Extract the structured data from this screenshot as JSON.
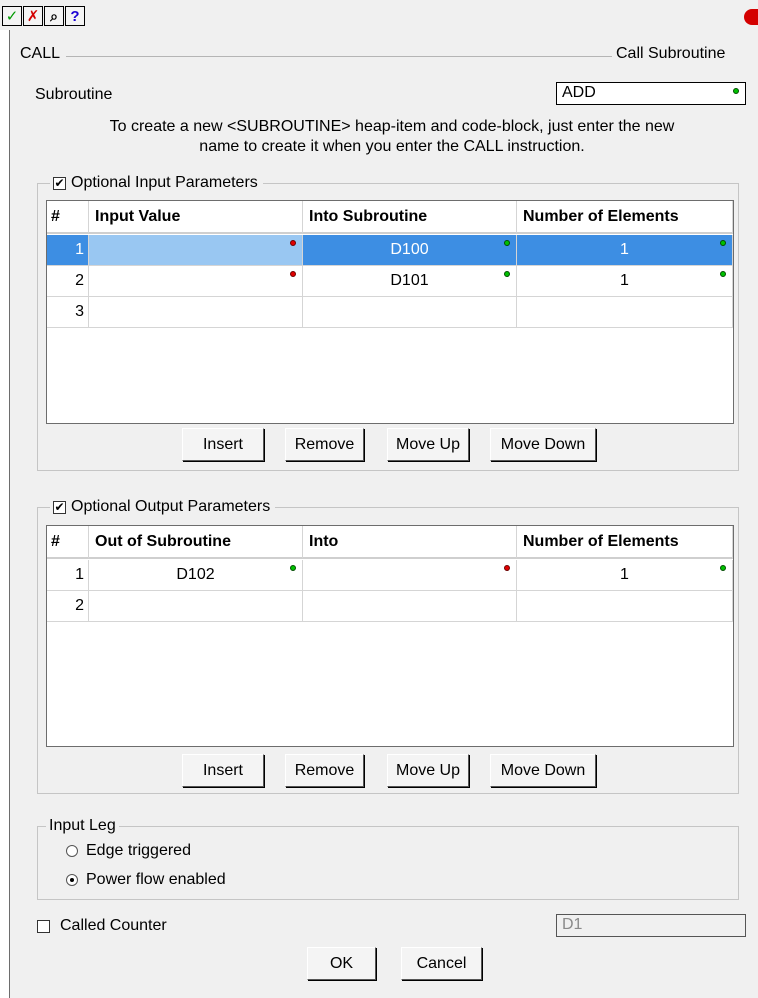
{
  "toolbar": {
    "buttons": [
      {
        "icon": "check-icon",
        "glyph": "✓",
        "color": "#009a00"
      },
      {
        "icon": "cancel-x-icon",
        "glyph": "✗",
        "color": "#d40000"
      },
      {
        "icon": "find-icon",
        "glyph": "⌕",
        "color": "#000000"
      },
      {
        "icon": "help-icon",
        "glyph": "?",
        "color": "#1a00d4"
      }
    ]
  },
  "header": {
    "instruction": "CALL",
    "title": "Call Subroutine"
  },
  "subroutine": {
    "label": "Subroutine",
    "value": "ADD",
    "hint_line1": "To create a new <SUBROUTINE> heap-item and code-block, just enter the new",
    "hint_line2": "name to create it when you enter the CALL instruction."
  },
  "input_params": {
    "title": "Optional Input Parameters",
    "checked": true,
    "columns": [
      "#",
      "Input Value",
      "Into Subroutine",
      "Number of Elements"
    ],
    "rows": [
      {
        "num": "1",
        "input": "",
        "into": "D100",
        "count": "1"
      },
      {
        "num": "2",
        "input": "",
        "into": "D101",
        "count": "1"
      },
      {
        "num": "3",
        "input": "",
        "into": "",
        "count": ""
      }
    ],
    "buttons": {
      "insert": "Insert",
      "remove": "Remove",
      "move_up": "Move Up",
      "move_down": "Move Down"
    }
  },
  "output_params": {
    "title": "Optional Output Parameters",
    "checked": true,
    "columns": [
      "#",
      "Out of Subroutine",
      "Into",
      "Number of Elements"
    ],
    "rows": [
      {
        "num": "1",
        "out": "D102",
        "into": "",
        "count": "1"
      },
      {
        "num": "2",
        "out": "",
        "into": "",
        "count": ""
      }
    ],
    "buttons": {
      "insert": "Insert",
      "remove": "Remove",
      "move_up": "Move Up",
      "move_down": "Move Down"
    }
  },
  "input_leg": {
    "title": "Input Leg",
    "options": [
      "Edge triggered",
      "Power flow enabled"
    ],
    "selected": "Power flow enabled"
  },
  "called_counter": {
    "label": "Called Counter",
    "checked": false,
    "value": "D1"
  },
  "footer": {
    "ok": "OK",
    "cancel": "Cancel"
  },
  "colors": {
    "selection": "#3d8ee3",
    "valid_dot": "#00c000",
    "invalid_dot": "#e00000"
  }
}
